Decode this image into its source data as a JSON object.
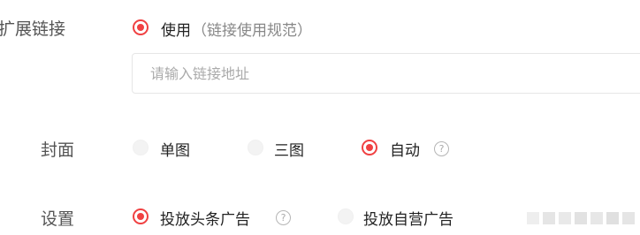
{
  "extend_link": {
    "label": "扩展链接",
    "option_label": "使用",
    "option_hint": "（链接使用规范）",
    "input_placeholder": "请输入链接地址"
  },
  "cover": {
    "label": "封面",
    "options": [
      "单图",
      "三图",
      "自动"
    ],
    "selected": "自动",
    "help": "?"
  },
  "settings": {
    "label": "设置",
    "options": [
      "投放头条广告",
      "投放自营广告"
    ],
    "selected": "投放头条广告",
    "help": "?"
  },
  "colors": {
    "accent": "#f04142",
    "label": "#555555",
    "border": "#e6e6e6"
  }
}
